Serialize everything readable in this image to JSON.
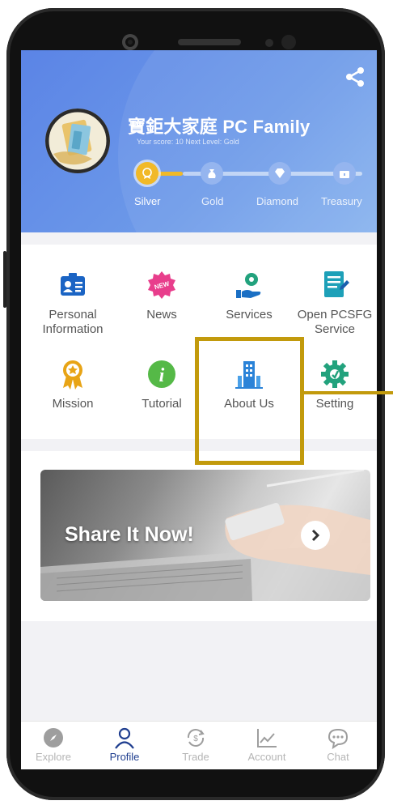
{
  "header": {
    "title": "寶鉅大家庭 PC Family",
    "score_line": "Your score: 10   Next Level: Gold",
    "levels": [
      "Silver",
      "Gold",
      "Diamond",
      "Treasury"
    ]
  },
  "menu": [
    {
      "label": "Personal\nInformation",
      "icon": "id-card-icon"
    },
    {
      "label": "News",
      "icon": "news-badge-icon"
    },
    {
      "label": "Services",
      "icon": "services-icon"
    },
    {
      "label": "Open PCSFG\nService",
      "icon": "document-icon"
    },
    {
      "label": "Mission",
      "icon": "medal-icon"
    },
    {
      "label": "Tutorial",
      "icon": "info-icon"
    },
    {
      "label": "About Us",
      "icon": "building-icon"
    },
    {
      "label": "Setting",
      "icon": "gear-icon"
    }
  ],
  "banner": {
    "text": "Share It Now!"
  },
  "nav": [
    {
      "label": "Explore",
      "icon": "compass-icon"
    },
    {
      "label": "Profile",
      "icon": "person-icon",
      "active": true
    },
    {
      "label": "Trade",
      "icon": "trade-icon"
    },
    {
      "label": "Account",
      "icon": "chart-icon"
    },
    {
      "label": "Chat",
      "icon": "chat-icon"
    }
  ],
  "colors": {
    "accent": "#1f3e8f",
    "header": "#5b84e6",
    "highlight": "#c29a0c",
    "gold": "#e8a416"
  }
}
